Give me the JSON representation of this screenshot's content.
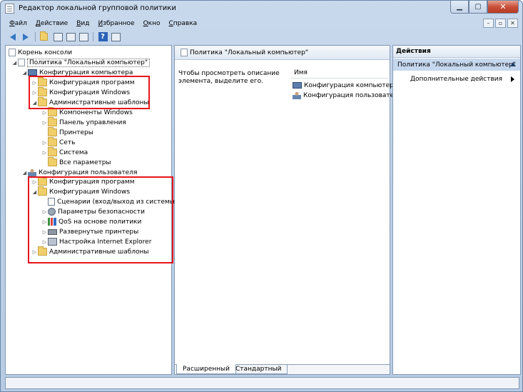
{
  "window": {
    "title": "Редактор локальной групповой политики"
  },
  "menu": [
    {
      "underline": "Ф",
      "rest": "айл"
    },
    {
      "underline": "Д",
      "rest": "ействие"
    },
    {
      "underline": "В",
      "rest": "ид"
    },
    {
      "underline": "И",
      "rest": "збранное"
    },
    {
      "underline": "О",
      "rest": "кно"
    },
    {
      "underline": "С",
      "rest": "правка"
    }
  ],
  "tree": {
    "root": "Корень консоли",
    "policy": "Политика \"Локальный компьютер\"",
    "computer_config": "Конфигурация компьютера",
    "cc_software": "Конфигурация программ",
    "cc_windows": "Конфигурация Windows",
    "cc_admin": "Административные шаблоны",
    "admin_children": [
      "Компоненты Windows",
      "Панель управления",
      "Принтеры",
      "Сеть",
      "Система",
      "Все параметры"
    ],
    "user_config": "Конфигурация пользователя",
    "uc_software": "Конфигурация программ",
    "uc_windows": "Конфигурация Windows",
    "win_children": [
      "Сценарии (вход/выход из системы)",
      "Параметры безопасности",
      "QoS на основе политики",
      "Развернутые принтеры",
      "Настройка Internet Explorer"
    ],
    "uc_admin": "Административные шаблоны"
  },
  "center": {
    "header": "Политика \"Локальный компьютер\"",
    "description": "Чтобы просмотреть описание элемента, выделите его.",
    "column_name": "Имя",
    "items": [
      "Конфигурация компьютера",
      "Конфигурация пользовате..."
    ],
    "tab_extended": "Расширенный",
    "tab_standard": "Стандартный"
  },
  "actions": {
    "title": "Действия",
    "group": "Политика \"Локальный компьютер\"",
    "more": "Дополнительные действия"
  },
  "colors": {
    "highlight": "#e8141b",
    "accent": "#3576c2"
  }
}
